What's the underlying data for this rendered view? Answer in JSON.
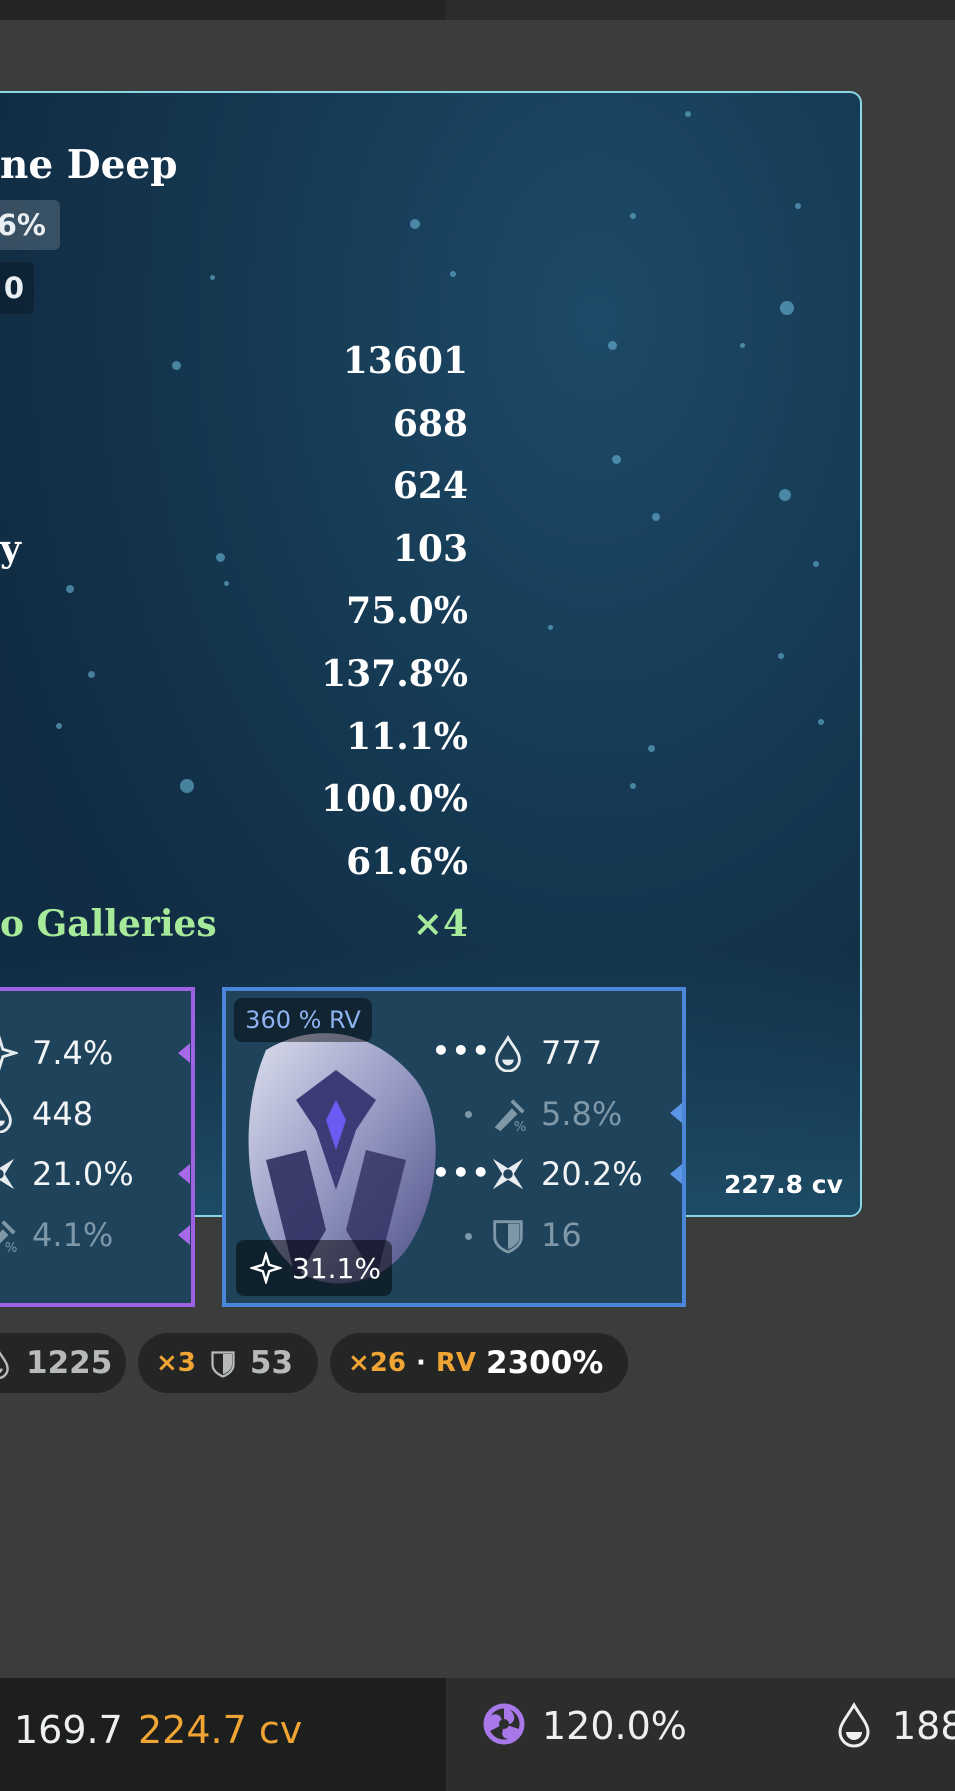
{
  "weapon": {
    "title": "ne Deep",
    "chip_1": "6%",
    "chip_2": "0"
  },
  "stats": [
    {
      "label": "",
      "value": "13601"
    },
    {
      "label": "",
      "value": "688"
    },
    {
      "label": "",
      "value": "624"
    },
    {
      "label": "y",
      "value": "103"
    },
    {
      "label": "",
      "value": "75.0%"
    },
    {
      "label": "",
      "value": "137.8%"
    },
    {
      "label": "",
      "value": "11.1%"
    },
    {
      "label": "",
      "value": "100.0%"
    },
    {
      "label": "",
      "value": "61.6%"
    },
    {
      "label": "o Galleries",
      "value": "×4"
    }
  ],
  "cv_total": "227.8 cv",
  "artifact_left": {
    "substats": [
      {
        "icon": "crit-rate-icon",
        "value": "7.4%"
      },
      {
        "icon": "hydro-elemental-mastery-icon",
        "value": "448"
      },
      {
        "icon": "crit-damage-icon",
        "value": "21.0%"
      },
      {
        "icon": "attack-percent-icon",
        "value": "4.1%"
      }
    ]
  },
  "artifact_right": {
    "rv_badge": "360 % RV",
    "main_stat": "31.1%",
    "substats": [
      {
        "icon": "hydro-elemental-mastery-icon",
        "value": "777"
      },
      {
        "icon": "attack-percent-icon",
        "value": "5.8%"
      },
      {
        "icon": "crit-damage-icon",
        "value": "20.2%"
      },
      {
        "icon": "defense-icon",
        "value": "16"
      }
    ]
  },
  "pills": {
    "p1_value": "1225",
    "p2_count": "×3",
    "p2_value": "53",
    "p3_count": "×26",
    "p3_dot": "·",
    "p3_label": "RV",
    "p3_value": "2300%"
  },
  "bottom_bar": {
    "left_value": "169.7",
    "left_cv": "224.7 cv",
    "right_percent": "120.0%",
    "right_value": "188"
  },
  "colors": {
    "accent_orange": "#f0a434",
    "highlight_green": "#a7ea9a",
    "card_border": "#8ad6e6",
    "purple_frame": "#9d62e2",
    "blue_frame": "#4c86d8"
  }
}
